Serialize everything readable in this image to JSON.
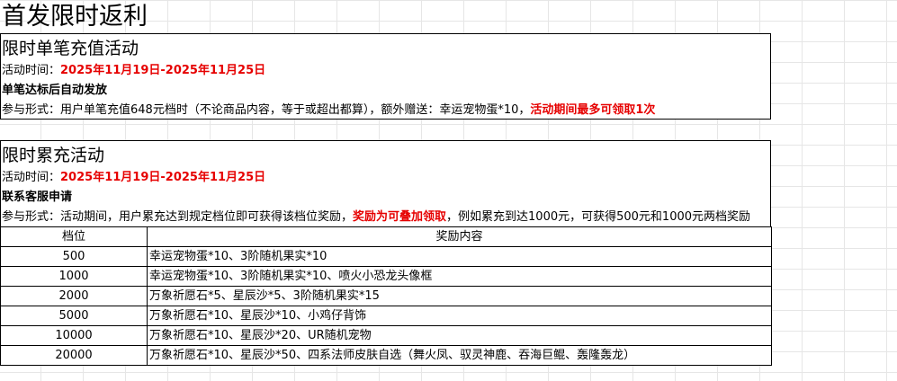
{
  "page_title": "首发限时返利",
  "sections": [
    {
      "title": "限时单笔充值活动",
      "time_label": "活动时间：",
      "time_value": "2025年11月19日-2025年11月25日",
      "note": "单笔达标后自动发放",
      "rule_prefix": "参与形式：用户单笔充值648元档时（不论商品内容，等于或超出都算），额外赠送：幸运宠物蛋*10，",
      "rule_highlight": "活动期间最多可领取1次",
      "rule_suffix": ""
    },
    {
      "title": "限时累充活动",
      "time_label": "活动时间：",
      "time_value": "2025年11月19日-2025年11月25日",
      "note": "联系客服申请",
      "rule_prefix": "参与形式：活动期间，用户累充达到规定档位即可获得该档位奖励，",
      "rule_highlight": "奖励为可叠加领取",
      "rule_suffix": "，例如累充到达1000元，可获得500元和1000元两档奖励"
    }
  ],
  "reward_table": {
    "headers": [
      "档位",
      "奖励内容"
    ],
    "rows": [
      {
        "level": "500",
        "reward": "幸运宠物蛋*10、3阶随机果实*10"
      },
      {
        "level": "1000",
        "reward": "幸运宠物蛋*10、3阶随机果实*10、喷火小恐龙头像框"
      },
      {
        "level": "2000",
        "reward": "万象祈愿石*5、星辰沙*5、3阶随机果实*15"
      },
      {
        "level": "5000",
        "reward": "万象祈愿石*10、星辰沙*10、小鸡仔背饰"
      },
      {
        "level": "10000",
        "reward": "万象祈愿石*10、星辰沙*20、UR随机宠物"
      },
      {
        "level": "20000",
        "reward": "万象祈愿石*10、星辰沙*50、四系法师皮肤自选（舞火凤、驭灵神鹿、吞海巨鲲、轰隆轰龙）"
      }
    ]
  }
}
